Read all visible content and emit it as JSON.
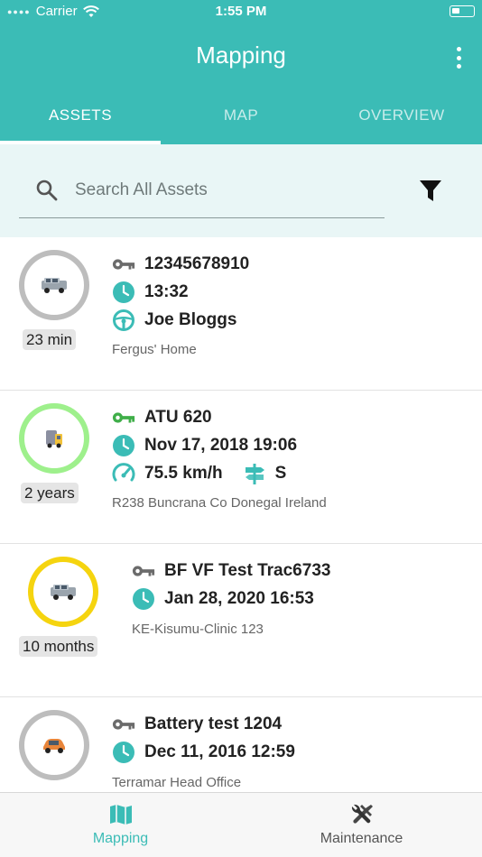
{
  "status_bar": {
    "carrier": "Carrier",
    "time": "1:55 PM"
  },
  "header": {
    "title": "Mapping"
  },
  "tabs": [
    {
      "label": "ASSETS",
      "active": true
    },
    {
      "label": "MAP",
      "active": false
    },
    {
      "label": "OVERVIEW",
      "active": false
    }
  ],
  "search": {
    "placeholder": "Search All Assets",
    "value": ""
  },
  "colors": {
    "primary": "#3bbcb6",
    "ring_grey": "#bdbdbd",
    "ring_green": "#9ef08c",
    "ring_yellow": "#f5d40f",
    "key_grey": "#6b6b6b",
    "key_green": "#3fae49",
    "teal_icon": "#3bbcb6"
  },
  "assets": [
    {
      "age": "23 min",
      "ring_color": "grey",
      "vehicle_icon": "suv-icon",
      "name": "12345678910",
      "key_color": "grey",
      "time": "13:32",
      "driver": "Joe Bloggs",
      "address": "Fergus' Home"
    },
    {
      "age": "2 years",
      "ring_color": "green",
      "vehicle_icon": "truck-icon",
      "name": "ATU 620",
      "key_color": "green",
      "time": "Nov 17, 2018 19:06",
      "speed": "75.5 km/h",
      "direction": "S",
      "address": "R238 Buncrana Co Donegal Ireland"
    },
    {
      "age": "10 months",
      "ring_color": "yellow",
      "vehicle_icon": "suv-icon",
      "name": "BF VF Test Trac6733",
      "key_color": "grey",
      "time": "Jan 28, 2020 16:53",
      "address": "KE-Kisumu-Clinic 123"
    },
    {
      "age": "",
      "ring_color": "grey",
      "vehicle_icon": "car-icon",
      "name": "Battery test 1204",
      "key_color": "grey",
      "time": "Dec 11, 2016 12:59",
      "address": "Terramar Head Office"
    }
  ],
  "bottom_nav": [
    {
      "label": "Mapping",
      "icon": "map-icon",
      "active": true
    },
    {
      "label": "Maintenance",
      "icon": "tools-icon",
      "active": false
    }
  ]
}
